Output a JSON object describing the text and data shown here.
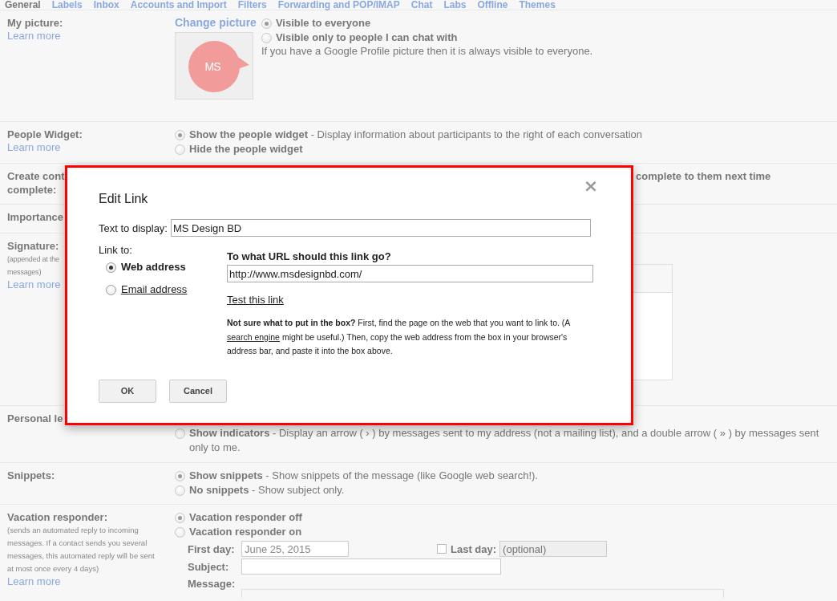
{
  "tabs": [
    {
      "label": "General",
      "selected": true
    },
    {
      "label": "Labels",
      "selected": false
    },
    {
      "label": "Inbox",
      "selected": false
    },
    {
      "label": "Accounts and Import",
      "selected": false
    },
    {
      "label": "Filters",
      "selected": false
    },
    {
      "label": "Forwarding and POP/IMAP",
      "selected": false
    },
    {
      "label": "Chat",
      "selected": false
    },
    {
      "label": "Labs",
      "selected": false
    },
    {
      "label": "Offline",
      "selected": false
    },
    {
      "label": "Themes",
      "selected": false
    }
  ],
  "sections": [
    {
      "kind": "picture",
      "label": "My picture:",
      "learn_more": "Learn more",
      "change_link": "Change picture",
      "logo_text": "MS",
      "options": [
        {
          "label": "Visible to everyone",
          "selected": true
        },
        {
          "label": "Visible only to people I can chat with",
          "selected": false
        }
      ],
      "note": "If you have a Google Profile picture then it is always visible to everyone."
    },
    {
      "kind": "options",
      "label": "People Widget:",
      "learn_more": "Learn more",
      "options": [
        {
          "label": "Show the people widget",
          "description": "- Display information about participants to the right of each conversation",
          "selected": true
        },
        {
          "label": "Hide the people widget",
          "selected": false
        }
      ]
    },
    {
      "kind": "covered",
      "label": "Create cont",
      "label_2": "complete:",
      "text": "complete to them next time"
    },
    {
      "kind": "covered",
      "label": "Importance"
    },
    {
      "kind": "signature",
      "label": "Signature:",
      "note": "(appended at the",
      "note_2": "messages)",
      "learn_more": "Learn more"
    },
    {
      "kind": "options",
      "label": "Personal le",
      "options": [
        {
          "label": "Show indicators",
          "description": "- Display an arrow ( › ) by messages sent to my address (not a mailing list), and a double arrow ( » ) by messages sent only to me.",
          "selected": false
        }
      ]
    },
    {
      "kind": "options",
      "label": "Snippets:",
      "options": [
        {
          "label": "Show snippets",
          "description": "- Show snippets of the message (like Google web search!).",
          "selected": true
        },
        {
          "label": "No snippets",
          "description": "- Show subject only.",
          "selected": false
        }
      ]
    },
    {
      "kind": "vacation",
      "label": "Vacation responder:",
      "note": "(sends an automated reply to incoming messages. If a contact sends you several messages, this automated reply will be sent at most once every 4 days)",
      "learn_more": "Learn more",
      "options": [
        {
          "label": "Vacation responder off",
          "selected": true
        },
        {
          "label": "Vacation responder on",
          "selected": false
        }
      ],
      "first_day": {
        "label": "First day:",
        "value": "June 25, 2015"
      },
      "last_day": {
        "label": "Last day:",
        "checked": false,
        "placeholder": "(optional)",
        "disabled": true
      },
      "subject": {
        "label": "Subject:"
      },
      "message": {
        "label": "Message:"
      }
    }
  ],
  "dialog": {
    "close": "×",
    "title": "Edit Link",
    "text_label": "Text to display:",
    "text_value": "MS Design BD",
    "link_to": "Link to:",
    "link_options": [
      {
        "label": "Web address",
        "selected": true
      },
      {
        "label": "Email address",
        "selected": false
      }
    ],
    "url_question": "To what URL should this link go?",
    "url_value": "http://www.msdesignbd.com/",
    "test_link": "Test this link",
    "help_lead": "Not sure what to put in the box?",
    "help_before": "First, find the page on the web that you want to link to. (A",
    "help_link": "search engine",
    "help_after": "might be useful.) Then, copy the web address from the box in your browser's address bar, and paste it into the box above.",
    "buttons": [
      "OK",
      "Cancel"
    ]
  }
}
